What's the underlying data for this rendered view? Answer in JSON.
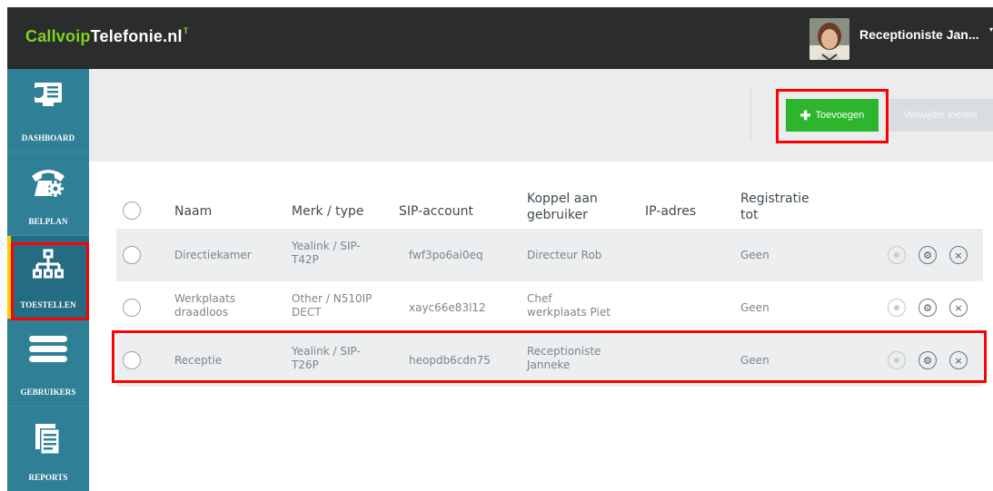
{
  "header": {
    "logo_part1": "Callvoip",
    "logo_part2": "Telefonie.nl",
    "logo_sup": "T",
    "username": "Receptioniste Jan...",
    "caret": "▾"
  },
  "sidebar": {
    "items": [
      {
        "label": "DASHBOARD",
        "icon": "dashboard-icon",
        "active": false
      },
      {
        "label": "BELPLAN",
        "icon": "phone-settings-icon",
        "active": false
      },
      {
        "label": "TOESTELLEN",
        "icon": "network-tree-icon",
        "active": true
      },
      {
        "label": "GEBRUIKERS",
        "icon": "users-menu-icon",
        "active": false
      },
      {
        "label": "REPORTS",
        "icon": "reports-icon",
        "active": false
      }
    ]
  },
  "toolbar": {
    "add_label": "Toevoegen",
    "add_plus": "✚",
    "delete_label": "Verwijder toestel"
  },
  "table": {
    "headers": {
      "naam": "Naam",
      "merk": "Merk / type",
      "sip": "SIP-account",
      "koppel_1": "Koppel aan",
      "koppel_2": "gebruiker",
      "ip": "IP-adres",
      "reg_1": "Registratie",
      "reg_2": "tot"
    },
    "rows": [
      {
        "naam": [
          "Directiekamer"
        ],
        "merk": [
          "Yealink / SIP-",
          "T42P"
        ],
        "sip": "fwf3po6ai0eq",
        "koppel": [
          "Directeur Rob"
        ],
        "ip": "",
        "reg": "Geen"
      },
      {
        "naam": [
          "Werkplaats",
          "draadloos"
        ],
        "merk": [
          "Other / N510IP",
          "DECT"
        ],
        "sip": "xayc66e83l12",
        "koppel": [
          "Chef",
          "werkplaats Piet"
        ],
        "ip": "",
        "reg": "Geen"
      },
      {
        "naam": [
          "Receptie"
        ],
        "merk": [
          "Yealink / SIP-",
          "T26P"
        ],
        "sip": "heopdb6cdn75",
        "koppel": [
          "Receptioniste",
          "Janneke"
        ],
        "ip": "",
        "reg": "Geen"
      }
    ],
    "action_icons": [
      "record-icon",
      "gear-icon",
      "close-icon"
    ],
    "gear_glyph": "⚙",
    "close_glyph": "×"
  },
  "colors": {
    "header_bg": "#2b2d2c",
    "sidebar_bg": "#2f7f97",
    "accent_green": "#7fd321",
    "add_button": "#2db52d",
    "highlight": "#ff0000"
  }
}
